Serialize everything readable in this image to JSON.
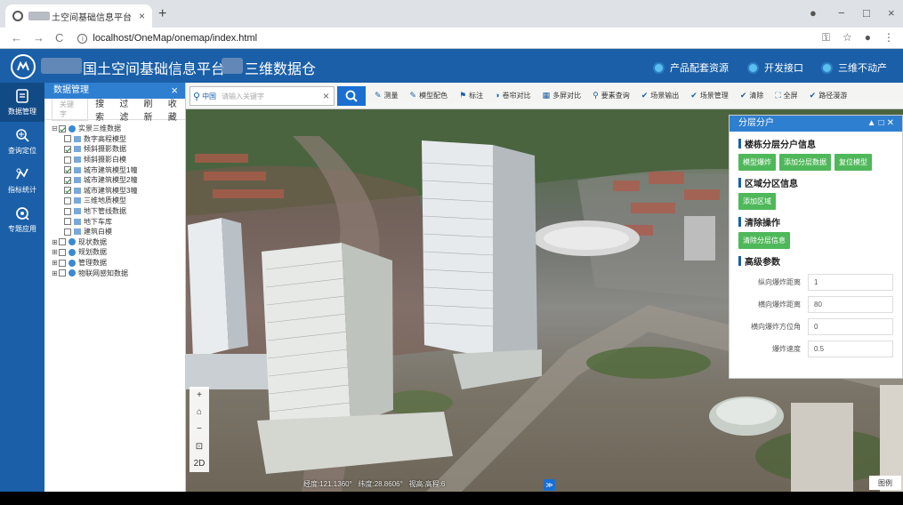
{
  "browser": {
    "tab_title": "土空间基础信息平台",
    "tab_close": "×",
    "new_tab": "+",
    "nav_back": "←",
    "nav_forward": "→",
    "nav_reload": "C",
    "url": "localhost/OneMap/onemap/index.html",
    "win_min": "−",
    "win_max": "□",
    "win_close": "×"
  },
  "header": {
    "title_part1": "国土空间基础信息平台",
    "title_part2": "三维数据仓",
    "nav": [
      "产品配套资源",
      "开发接口",
      "三维不动产"
    ]
  },
  "rail": [
    {
      "label": "数据管理",
      "icon": "document-icon"
    },
    {
      "label": "查询定位",
      "icon": "locate-icon"
    },
    {
      "label": "指标统计",
      "icon": "statistics-icon"
    },
    {
      "label": "专题应用",
      "icon": "thematic-icon"
    }
  ],
  "data_panel": {
    "title": "数据管理",
    "close": "×",
    "tabs": [
      "关键字",
      "搜索",
      "过滤",
      "刷新",
      "收藏"
    ],
    "tree": [
      {
        "label": "实景三维数据",
        "level": 0,
        "checked": true,
        "type": "group",
        "expand": "⊟"
      },
      {
        "label": "数字高程模型",
        "level": 1,
        "checked": false,
        "type": "layer"
      },
      {
        "label": "倾斜摄影数据",
        "level": 1,
        "checked": true,
        "type": "layer"
      },
      {
        "label": "倾斜摄影白模",
        "level": 1,
        "checked": false,
        "type": "layer"
      },
      {
        "label": "城市建筑模型1幢",
        "level": 1,
        "checked": true,
        "type": "layer"
      },
      {
        "label": "城市建筑模型2幢",
        "level": 1,
        "checked": true,
        "type": "layer"
      },
      {
        "label": "城市建筑模型3幢",
        "level": 1,
        "checked": true,
        "type": "layer"
      },
      {
        "label": "三维地质模型",
        "level": 1,
        "checked": false,
        "type": "layer"
      },
      {
        "label": "地下管线数据",
        "level": 1,
        "checked": false,
        "type": "layer"
      },
      {
        "label": "地下车库",
        "level": 1,
        "checked": false,
        "type": "layer"
      },
      {
        "label": "建筑白模",
        "level": 1,
        "checked": false,
        "type": "layer"
      },
      {
        "label": "现状数据",
        "level": 0,
        "checked": false,
        "type": "group",
        "expand": "⊞"
      },
      {
        "label": "规划数据",
        "level": 0,
        "checked": false,
        "type": "group",
        "expand": "⊞"
      },
      {
        "label": "管理数据",
        "level": 0,
        "checked": false,
        "type": "group",
        "expand": "⊞"
      },
      {
        "label": "物联网感知数据",
        "level": 0,
        "checked": false,
        "type": "group",
        "expand": "⊞"
      }
    ]
  },
  "map": {
    "search_city": "中国",
    "search_placeholder": "请输入关键字",
    "search_clear": "×",
    "tools": [
      "测量",
      "模型配色",
      "标注",
      "卷帘对比",
      "多屏对比",
      "要素查询",
      "场景输出",
      "场景管理",
      "清除",
      "全屏",
      "路径漫游"
    ],
    "controls": [
      "+",
      "⌂",
      "−",
      "⊡",
      "2D"
    ],
    "coord_lon": "经度:121.1360°",
    "coord_lat": "纬度:28.8606°",
    "coord_extra": "视高:高程:6",
    "expand_icon": "≫",
    "legend": "图例"
  },
  "division_panel": {
    "title": "分层分户",
    "sections": {
      "layer_info": "楼栋分层分户信息",
      "region_info": "区域分区信息",
      "clear": "清除操作",
      "advanced": "高级参数"
    },
    "buttons": {
      "model_explode": "模型爆炸",
      "add_division_data": "添加分层数据",
      "reset_model": "复位模型",
      "add_region": "添加区域",
      "clear_division": "清除分层信息"
    },
    "params": [
      {
        "label": "纵向爆炸距离",
        "value": "1"
      },
      {
        "label": "横向爆炸距离",
        "value": "80"
      },
      {
        "label": "横向爆炸方位角",
        "value": "0"
      },
      {
        "label": "爆炸速度",
        "value": "0.5"
      }
    ]
  }
}
